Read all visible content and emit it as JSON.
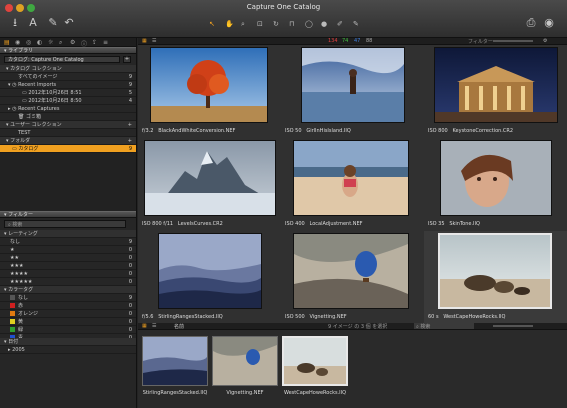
{
  "window": {
    "title": "Capture One Catalog"
  },
  "toolbar": {
    "badge": {
      "red": "134",
      "green": "74",
      "blue": "47",
      "gray": "88"
    },
    "filter_label": "フィルター"
  },
  "library": {
    "header": "ライブラリ",
    "catalog_select": "カタログ: Capture One Catalog",
    "catalog_collection": "カタログ コレクション",
    "all_images": {
      "label": "すべてのイメージ",
      "count": "9"
    },
    "recent_imports": {
      "label": "Recent Imports",
      "count": "9"
    },
    "import1": {
      "label": "2012年10月26日 8:51",
      "count": "5"
    },
    "import2": {
      "label": "2012年10月26日 8:50",
      "count": "4"
    },
    "recent_captures": "Recent Captures",
    "trash": "ゴミ箱",
    "user_collection": "ユーザー コレクション",
    "test": "TEST",
    "folders": "フォルダ",
    "catalog_folder": {
      "label": "カタログ",
      "count": "9"
    }
  },
  "filters": {
    "header": "フィルター",
    "search_placeholder": "検索",
    "rating_header": "レーティング",
    "ratings": [
      {
        "label": "なし",
        "count": "9"
      },
      {
        "label": "★",
        "count": "0"
      },
      {
        "label": "★★",
        "count": "0"
      },
      {
        "label": "★★★",
        "count": "0"
      },
      {
        "label": "★★★★",
        "count": "0"
      },
      {
        "label": "★★★★★",
        "count": "0"
      }
    ],
    "colortag_header": "カラータグ",
    "colortags": [
      {
        "label": "なし",
        "count": "9",
        "color": "#555555"
      },
      {
        "label": "赤",
        "count": "0",
        "color": "#d02020"
      },
      {
        "label": "オレンジ",
        "count": "0",
        "color": "#e07a10"
      },
      {
        "label": "黄",
        "count": "0",
        "color": "#e0d020"
      },
      {
        "label": "緑",
        "count": "0",
        "color": "#30a030"
      },
      {
        "label": "青",
        "count": "0",
        "color": "#2050d0"
      },
      {
        "label": "ピンク",
        "count": "0",
        "color": "#e060b0"
      },
      {
        "label": "紫",
        "count": "0",
        "color": "#8040c0"
      }
    ],
    "date_header": "日付",
    "year": "2005"
  },
  "browser": {
    "images": [
      {
        "meta": "f/3.2",
        "name": "BlackAndWhiteConversion.NEF"
      },
      {
        "meta": "ISO 50",
        "name": "GirlInHisIsland.IIQ"
      },
      {
        "meta": "ISO 800",
        "name": "KeystoneCorrection.CR2"
      },
      {
        "meta": "ISO 800   f/11",
        "name": "LevelsCurves.CR2"
      },
      {
        "meta": "ISO 400",
        "name": "LocalAdjustment.NEF"
      },
      {
        "meta": "ISO 35",
        "name": "SkinTone.IIQ"
      },
      {
        "meta": "f/5.6",
        "name": "StirlingRangesStacked.IIQ"
      },
      {
        "meta": "ISO 500",
        "name": "Vignetting.NEF"
      },
      {
        "meta": "60 s",
        "name": "WestCapeHoweRocks.IIQ"
      }
    ],
    "sort_label": "名前",
    "selection_hint": "9 イメージ の 3 個 を選択",
    "search_placeholder": "検索"
  },
  "filmstrip": [
    {
      "name": "StirlingRangesStacked.IIQ"
    },
    {
      "name": "Vignetting.NEF"
    },
    {
      "name": "WestCapeHoweRocks.IIQ"
    }
  ]
}
